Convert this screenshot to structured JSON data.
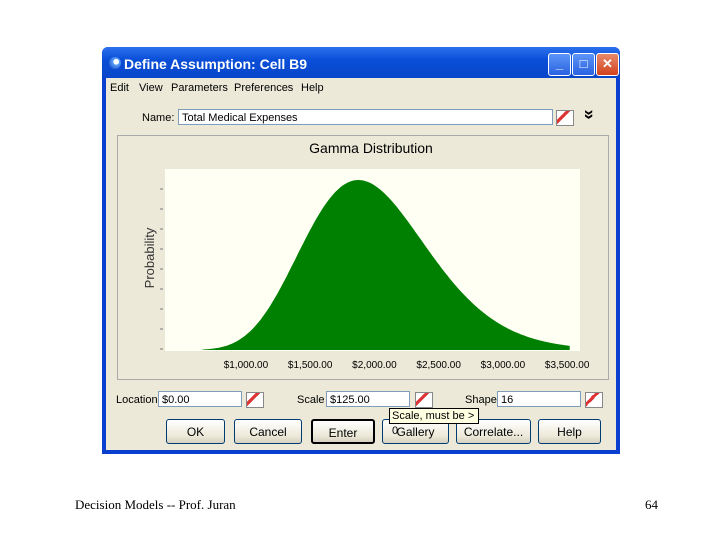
{
  "window": {
    "title": "Define Assumption: Cell B9",
    "minimize": "_",
    "maximize": "□",
    "close": "✕"
  },
  "menu": [
    "Edit",
    "View",
    "Parameters",
    "Preferences",
    "Help"
  ],
  "name": {
    "label": "Name:",
    "value": "Total Medical Expenses"
  },
  "chart_data": {
    "type": "area",
    "title": "Gamma Distribution",
    "ylabel": "Probability",
    "xlabel": "",
    "distribution": "gamma",
    "location": 0,
    "scale": 125,
    "shape": 16,
    "x_range": [
      660,
      3520
    ],
    "xlim": [
      370,
      3600
    ],
    "xticks": [
      1000,
      1500,
      2000,
      2500,
      3000,
      3500
    ],
    "xtick_labels": [
      "$1,000.00",
      "$1,500.00",
      "$2,000.00",
      "$2,500.00",
      "$3,000.00",
      "$3,500.00"
    ],
    "color": "#008000"
  },
  "params": {
    "location_label": "Location",
    "location_value": "$0.00",
    "scale_label": "Scale",
    "scale_value": "$125.00",
    "shape_label": "Shape",
    "shape_value": "16"
  },
  "tooltip": "Scale, must be > 0",
  "buttons": [
    "OK",
    "Cancel",
    "Enter",
    "Gallery",
    "Correlate...",
    "Help"
  ],
  "footer": {
    "left": "Decision Models -- Prof. Juran",
    "page": "64"
  }
}
